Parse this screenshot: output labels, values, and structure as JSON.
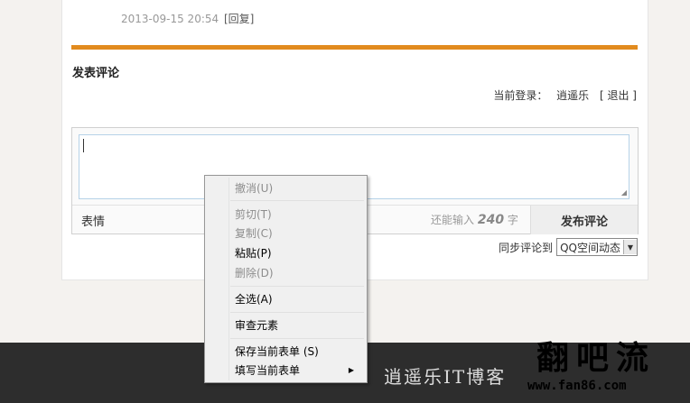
{
  "comment_meta": {
    "timestamp": "2013-09-15 20:54",
    "reply_label": "[回复]"
  },
  "section_title": "发表评论",
  "login": {
    "prefix": "当前登录：",
    "user": "逍遥乐",
    "logout": "[ 退出 ]"
  },
  "editor": {
    "emoji_label": "表情",
    "remain_prefix": "还能输入",
    "remain_count": "240",
    "remain_suffix": "字",
    "publish_label": "发布评论"
  },
  "sync": {
    "label": "同步评论到",
    "selected": "QQ空间动态"
  },
  "context_menu": {
    "undo": "撤消(U)",
    "cut": "剪切(T)",
    "copy": "复制(C)",
    "paste": "粘贴(P)",
    "delete": "删除(D)",
    "select_all": "全选(A)",
    "inspect": "审查元素",
    "save_form": "保存当前表单 (S)",
    "fill_form": "填写当前表单"
  },
  "footer": {
    "title": "逍遥乐IT博客"
  },
  "watermark": {
    "glyphs": "翻吧流",
    "url": "www.fan86.com"
  },
  "colors": {
    "accent_bar": "#e28b1e",
    "footer_bg": "#2d2d2d"
  }
}
